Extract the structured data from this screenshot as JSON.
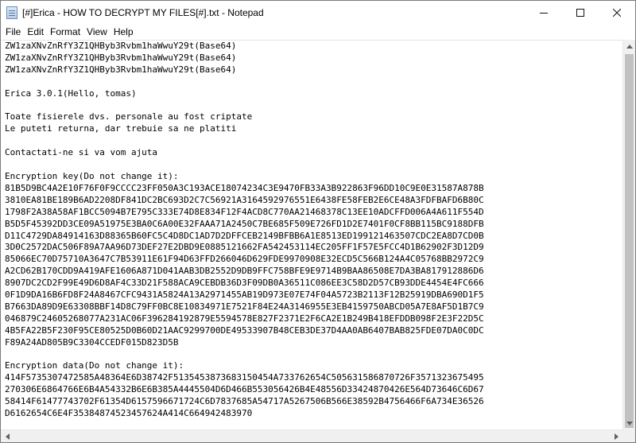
{
  "window": {
    "title": "[#]Erica - HOW TO DECRYPT MY FILES[#].txt - Notepad",
    "minimize_icon": "minimize-icon",
    "maximize_icon": "maximize-icon",
    "close_icon": "close-icon"
  },
  "menu": {
    "items": [
      "File",
      "Edit",
      "Format",
      "View",
      "Help"
    ]
  },
  "document": {
    "lines": [
      "ZW1zaXNvZnRfY3Z1QHByb3Rvbm1haWwuY29t(Base64)",
      "ZW1zaXNvZnRfY3Z1QHByb3Rvbm1haWwuY29t(Base64)",
      "ZW1zaXNvZnRfY3Z1QHByb3Rvbm1haWwuY29t(Base64)",
      "",
      "Erica 3.0.1(Hello, tomas)",
      "",
      "Toate fisierele dvs. personale au fost criptate",
      "Le puteti returna, dar trebuie sa ne platiti",
      "",
      "Contactati-ne si va vom ajuta",
      "",
      "Encryption key(Do not change it):",
      "81B5D9BC4A2E10F76F0F9CCCC23FF050A3C193ACE18074234C3E9470FB33A3B922863F96DD10C9E0E31587A878B",
      "3810EA81BE189B6AD2208DF841DC2BC693D2C7C56921A3164592976551E6438FE58FEB2E6CE48A3FDFBAFD6B80C",
      "1798F2A38A58AF1BCC5094B7E795C333E74D8E834F12F4ACD8C770AA21468378C13EE10ADCFFD006A4A611F554D",
      "B5D5F45392DD3CE09A51975E3BA0C6A00E32FAAA71A2450C7BE685F509E726FD1D2E7401F0CF8BB115BC9188DFB",
      "D11C4729DA84914163D88365B60FC5C4D8DC1AD7D2DFFCEB2149BFBB6A1E8513ED199121463507CDC2EA8D7CD0B",
      "3D0C2572DAC506F89A7AA96D73DEF27E2DBD9E0885121662FA542453114EC205FF1F57E5FCC4D1B62902F3D12D9",
      "85066EC70D75710A3647C7B53911E61F94D63FFD266046D629FDE9970908E32ECD5C566B124A4C05768BB2972C9",
      "A2CD62B170CDD9A419AFE1606A871D041AAB3DB2552D9DB9FFC758BFE9E9714B9BAA86508E7DA3BA817912886D6",
      "8907DC2CD2F99E49D6D8AF4C33D21F588ACA9CEBDB36D3F09DB0A36511C086EE3C58D2D57CB93DDE4454E4FC666",
      "0F1D9DA16B6FD8F24A8467CFC9431A5824A13A2971455AB19D973E07E74F04A5723B2113F12B25919DBA690D1F5",
      "B7663DA89D9E63308BBF14D8C79FF0BC8E10834971E7521F84E24A3146955E3EB4159750ABCD05A7E8AF5D1B7C9",
      "046879C24605268077A231AC06F396284192879E5594578E827F2371E2F6CA2E1B249B418EFDDB098F2E3F22D5C",
      "4B5FA22B5F230F95CE80525D0B60D21AAC9299700DE49533907B48CEB3DE37D4AA0AB6407BAB825FDE07DA0C0DC",
      "F89A24AD805B9C3304CCEDF015D823D5B",
      "",
      "Encryption data(Do not change it):",
      "414F5735307472585A48364E6D38742F5135453873683150454A733762654C505631586870726F3571323675495",
      "270306E6864766E6B4A54332B6E6B385A4445504D6D466B553056426B4E48556D33424870426E564D73646C6D67",
      "58414F61477743702F61354D6157596671724C6D7837685A54717A5267506B566E38592B4756466F6A734E36526",
      "D6162654C6E4F35384874523457624A414C664942483970"
    ]
  }
}
